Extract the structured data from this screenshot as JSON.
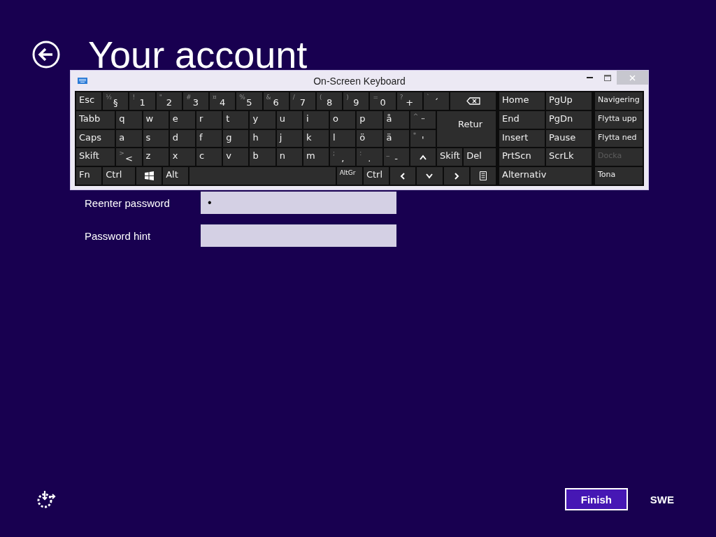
{
  "page": {
    "title": "Your account"
  },
  "keyboard": {
    "title": "On-Screen Keyboard",
    "main_rows": [
      [
        {
          "kind": "key",
          "label": "Esc"
        },
        {
          "kind": "key",
          "label": "§",
          "shift": "½"
        },
        {
          "kind": "key",
          "label": "1",
          "shift": "!"
        },
        {
          "kind": "key",
          "label": "2",
          "shift": "\""
        },
        {
          "kind": "key",
          "label": "3",
          "shift": "#"
        },
        {
          "kind": "key",
          "label": "4",
          "shift": "¤"
        },
        {
          "kind": "key",
          "label": "5",
          "shift": "%"
        },
        {
          "kind": "key",
          "label": "6",
          "shift": "&"
        },
        {
          "kind": "key",
          "label": "7",
          "shift": "/"
        },
        {
          "kind": "key",
          "label": "8",
          "shift": "("
        },
        {
          "kind": "key",
          "label": "9",
          "shift": ")"
        },
        {
          "kind": "key",
          "label": "0",
          "shift": "="
        },
        {
          "kind": "key",
          "label": "+",
          "shift": "?"
        },
        {
          "kind": "key",
          "label": "´",
          "shift": "`"
        },
        {
          "kind": "backspace"
        }
      ],
      [
        {
          "kind": "key",
          "label": "Tabb"
        },
        {
          "kind": "key",
          "label": "q"
        },
        {
          "kind": "key",
          "label": "w"
        },
        {
          "kind": "key",
          "label": "e"
        },
        {
          "kind": "key",
          "label": "r"
        },
        {
          "kind": "key",
          "label": "t"
        },
        {
          "kind": "key",
          "label": "y"
        },
        {
          "kind": "key",
          "label": "u"
        },
        {
          "kind": "key",
          "label": "i"
        },
        {
          "kind": "key",
          "label": "o"
        },
        {
          "kind": "key",
          "label": "p"
        },
        {
          "kind": "key",
          "label": "å"
        },
        {
          "kind": "key",
          "label": "¨",
          "shift": "^"
        },
        {
          "kind": "enter",
          "label": "Retur"
        }
      ],
      [
        {
          "kind": "key",
          "label": "Caps"
        },
        {
          "kind": "key",
          "label": "a"
        },
        {
          "kind": "key",
          "label": "s"
        },
        {
          "kind": "key",
          "label": "d"
        },
        {
          "kind": "key",
          "label": "f"
        },
        {
          "kind": "key",
          "label": "g"
        },
        {
          "kind": "key",
          "label": "h"
        },
        {
          "kind": "key",
          "label": "j"
        },
        {
          "kind": "key",
          "label": "k"
        },
        {
          "kind": "key",
          "label": "l"
        },
        {
          "kind": "key",
          "label": "ö"
        },
        {
          "kind": "key",
          "label": "ä"
        },
        {
          "kind": "key",
          "label": "'",
          "shift": "*"
        }
      ],
      [
        {
          "kind": "key",
          "label": "Skift"
        },
        {
          "kind": "key",
          "label": "<",
          "shift": ">"
        },
        {
          "kind": "key",
          "label": "z"
        },
        {
          "kind": "key",
          "label": "x"
        },
        {
          "kind": "key",
          "label": "c"
        },
        {
          "kind": "key",
          "label": "v"
        },
        {
          "kind": "key",
          "label": "b"
        },
        {
          "kind": "key",
          "label": "n"
        },
        {
          "kind": "key",
          "label": "m"
        },
        {
          "kind": "key",
          "label": ",",
          "shift": ";"
        },
        {
          "kind": "key",
          "label": ".",
          "shift": ":"
        },
        {
          "kind": "key",
          "label": "-",
          "shift": "_"
        },
        {
          "kind": "up"
        },
        {
          "kind": "key",
          "label": "Skift"
        },
        {
          "kind": "key",
          "label": "Del"
        }
      ],
      [
        {
          "kind": "key",
          "label": "Fn"
        },
        {
          "kind": "key",
          "label": "Ctrl"
        },
        {
          "kind": "windows"
        },
        {
          "kind": "key",
          "label": "Alt"
        },
        {
          "kind": "space"
        },
        {
          "kind": "small",
          "label": "AltGr"
        },
        {
          "kind": "key",
          "label": "Ctrl"
        },
        {
          "kind": "left"
        },
        {
          "kind": "down"
        },
        {
          "kind": "right"
        },
        {
          "kind": "menu"
        }
      ]
    ],
    "nav_keys": [
      {
        "label": "Home",
        "wide": false
      },
      {
        "label": "PgUp",
        "wide": false
      },
      {
        "label": "End",
        "wide": false
      },
      {
        "label": "PgDn",
        "wide": false
      },
      {
        "label": "Insert",
        "wide": false
      },
      {
        "label": "Pause",
        "wide": false
      },
      {
        "label": "PrtScn",
        "wide": false
      },
      {
        "label": "ScrLk",
        "wide": false
      },
      {
        "label": "Alternativ",
        "wide": true
      }
    ],
    "side_keys": [
      {
        "label": "Navigering",
        "disabled": false
      },
      {
        "label": "Flytta upp",
        "disabled": false
      },
      {
        "label": "Flytta ned",
        "disabled": false
      },
      {
        "label": "Docka",
        "disabled": true
      },
      {
        "label": "Tona",
        "disabled": false
      }
    ]
  },
  "fields": [
    {
      "label": "Reenter password",
      "value": "•"
    },
    {
      "label": "Password hint"
    }
  ],
  "finish_button": "Finish",
  "language": "SWE"
}
